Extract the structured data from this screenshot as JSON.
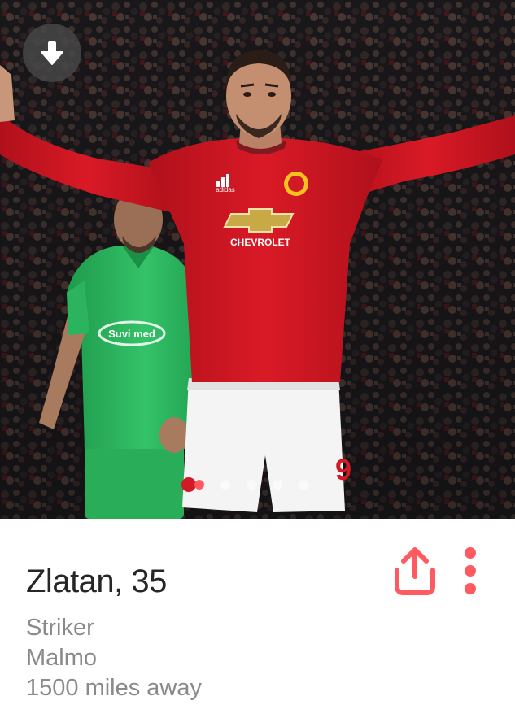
{
  "profile": {
    "name_age": "Zlatan, 35",
    "job": "Striker",
    "school": "Malmo",
    "distance": "1500 miles away"
  },
  "photo": {
    "shirt_sponsor": "CHEVROLET",
    "kit_brand": "adidas",
    "opponent_sponsor": "Suvi med",
    "shorts_number": "9",
    "photo_count": 5,
    "current_photo_index": 1
  },
  "colors": {
    "accent": "#ff5a5f",
    "name_text": "#262626",
    "detail_text": "#8a8a8a",
    "home_kit_red": "#cc1420",
    "away_kit_green": "#2bb35e"
  },
  "icons": {
    "collapse": "arrow-down-icon",
    "share": "share-icon",
    "more": "more-vertical-icon"
  }
}
